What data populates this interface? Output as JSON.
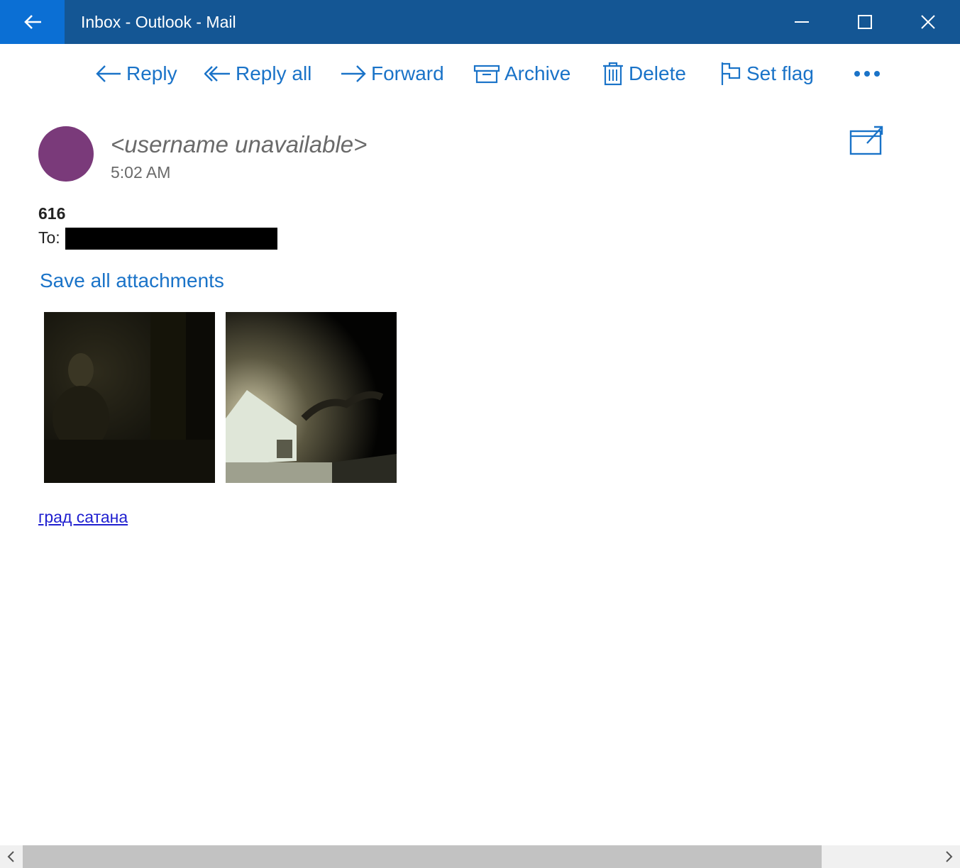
{
  "window": {
    "title": "Inbox - Outlook - Mail"
  },
  "toolbar": {
    "reply": "Reply",
    "reply_all": "Reply all",
    "forward": "Forward",
    "archive": "Archive",
    "delete": "Delete",
    "set_flag": "Set flag"
  },
  "message": {
    "sender": "<username unavailable>",
    "time": "5:02 AM",
    "subject": "616",
    "to_label": "To:",
    "save_all": "Save all attachments",
    "link_text": "град сатана"
  },
  "colors": {
    "title_bar": "#145694",
    "back_button": "#0b6fd4",
    "accent": "#1a73c8",
    "avatar": "#7a3a7a",
    "link": "#2020d0"
  }
}
